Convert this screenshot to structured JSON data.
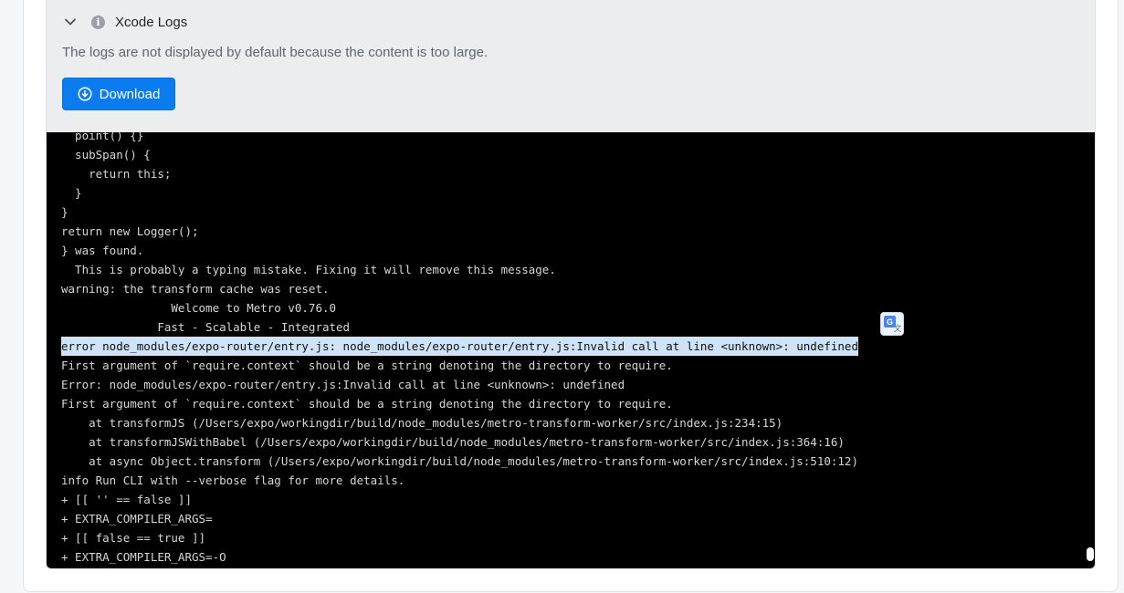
{
  "section": {
    "title": "Xcode Logs",
    "notice": "The logs are not displayed by default because the content is too large."
  },
  "download_button": {
    "label": "Download",
    "color": "#0a7cf0"
  },
  "icons": {
    "toggle": "chevron-down-icon",
    "info": "info-icon",
    "download": "download-circle-icon",
    "translate": "google-translate-icon"
  },
  "log": {
    "selected_line_index": 11,
    "lines": [
      "  point() {}",
      "  subSpan() {",
      "    return this;",
      "  }",
      "}",
      "return new Logger();",
      "} was found.",
      "  This is probably a typing mistake. Fixing it will remove this message.",
      "warning: the transform cache was reset.",
      "                Welcome to Metro v0.76.0",
      "              Fast - Scalable - Integrated",
      "error node_modules/expo-router/entry.js: node_modules/expo-router/entry.js:Invalid call at line <unknown>: undefined",
      "First argument of `require.context` should be a string denoting the directory to require.",
      "Error: node_modules/expo-router/entry.js:Invalid call at line <unknown>: undefined",
      "First argument of `require.context` should be a string denoting the directory to require.",
      "    at transformJS (/Users/expo/workingdir/build/node_modules/metro-transform-worker/src/index.js:234:15)",
      "    at transformJSWithBabel (/Users/expo/workingdir/build/node_modules/metro-transform-worker/src/index.js:364:16)",
      "    at async Object.transform (/Users/expo/workingdir/build/node_modules/metro-transform-worker/src/index.js:510:12)",
      "info Run CLI with --verbose flag for more details.",
      "+ [[ '' == false ]]",
      "+ EXTRA_COMPILER_ARGS=",
      "+ [[ false == true ]]",
      "+ EXTRA_COMPILER_ARGS=-O"
    ]
  }
}
